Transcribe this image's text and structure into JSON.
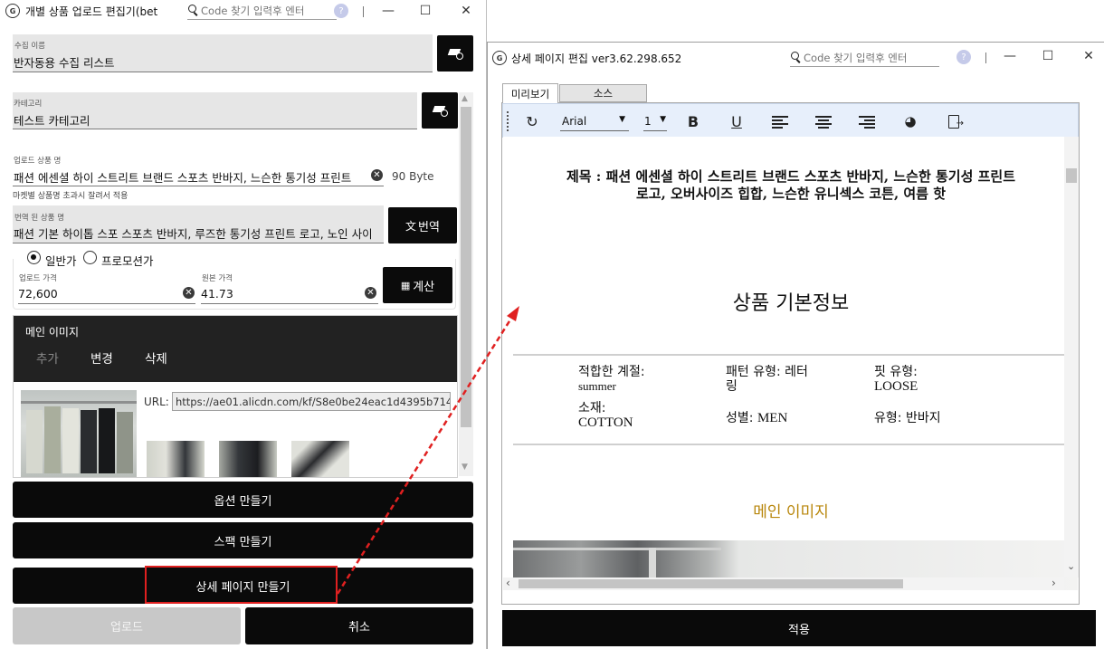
{
  "left_window": {
    "title": "개별 상품 업로드 편집기(bet",
    "search_placeholder": "Code 찾기 입력후 엔터",
    "help_badge": "?",
    "collection_name": {
      "label": "수집 이름",
      "value": "반자동용 수집 리스트"
    },
    "category": {
      "label": "카테고리",
      "value": "테스트 카테고리"
    },
    "product_name": {
      "label": "업로드 상품 명",
      "value": "패션 에센셜 하이 스트리트 브랜드 스포츠 반바지, 느슨한 통기성 프린트",
      "byte_count": "90 Byte",
      "note": "마켓별 상품명 초과시 잘려서 적용"
    },
    "translated_name": {
      "label": "번역 된 상품 명",
      "value": "패션 기본 하이톱 스포 스포츠 반바지, 루즈한 통기성 프린트 로고, 노인 사이",
      "button": "번역"
    },
    "price_type": {
      "options": [
        "일반가",
        "프로모션가"
      ],
      "selected": "일반가"
    },
    "upload_price": {
      "label": "업로드 가격",
      "value": "72,600"
    },
    "original_price": {
      "label": "원본 가격",
      "value": "41.73"
    },
    "calc_button": "계산",
    "main_image": {
      "title": "메인 이미지",
      "actions": [
        "추가",
        "변경",
        "삭제"
      ],
      "url_label": "URL:",
      "url_value": "https://ae01.alicdn.com/kf/S8e0be24eac1d4395b71477d"
    },
    "buttons": {
      "options": "옵션 만들기",
      "spec": "스팩 만들기",
      "detail": "상세 페이지 만들기",
      "upload": "업로드",
      "cancel": "취소"
    }
  },
  "right_window": {
    "title": "상세 페이지 편집 ver3.62.298.652",
    "search_placeholder": "Code 찾기 입력후 엔터",
    "help_badge": "?",
    "tabs": [
      "미리보기",
      "소스"
    ],
    "active_tab": "미리보기",
    "toolbar": {
      "font": "Arial",
      "size": "1"
    },
    "preview": {
      "title_line1": "제목 : 패션 에센셜 하이 스트리트 브랜드 스포츠 반바지, 느슨한 통기성 프린트",
      "title_line2": "로고, 오버사이즈 힙합, 느슨한 유니섹스 코튼, 여름 핫",
      "section_basic": "상품 기본정보",
      "specs": [
        {
          "label": "적합한 계절:",
          "value": "summer"
        },
        {
          "label": "패턴 유형: 레터링",
          "value": ""
        },
        {
          "label": "핏 유형:",
          "value": "LOOSE"
        },
        {
          "label": "소재:",
          "value": "COTTON"
        },
        {
          "label": "성별:",
          "value": "MEN"
        },
        {
          "label": "유형:",
          "value": "반바지"
        }
      ],
      "section_main_image": "메인 이미지",
      "section_main_image_color": "#b8860b"
    },
    "apply_button": "적용"
  },
  "colors": {
    "dark_button": "#0a0a0a",
    "annotation_red": "#e02020",
    "disabled_button": "#c8c8c8"
  }
}
